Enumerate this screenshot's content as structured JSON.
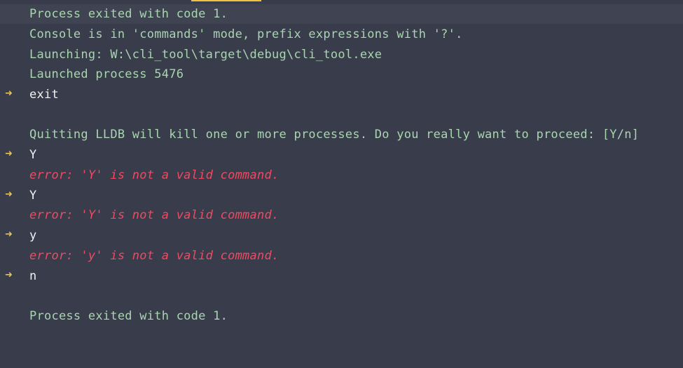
{
  "console": {
    "lines": [
      {
        "kind": "output",
        "text": "Process exited with code 1."
      },
      {
        "kind": "output",
        "text": "Console is in 'commands' mode, prefix expressions with '?'."
      },
      {
        "kind": "output",
        "text": "Launching: W:\\cli_tool\\target\\debug\\cli_tool.exe"
      },
      {
        "kind": "output",
        "text": "Launched process 5476"
      },
      {
        "kind": "command",
        "prompt": "➜",
        "text": "exit"
      },
      {
        "kind": "output",
        "text": "Quitting LLDB will kill one or more processes. Do you really want to proceed: [Y/n]"
      },
      {
        "kind": "command",
        "prompt": "➜",
        "text": "Y"
      },
      {
        "kind": "error",
        "text": "error: 'Y' is not a valid command."
      },
      {
        "kind": "command",
        "prompt": "➜",
        "text": "Y"
      },
      {
        "kind": "error",
        "text": "error: 'Y' is not a valid command."
      },
      {
        "kind": "command",
        "prompt": "➜",
        "text": "y"
      },
      {
        "kind": "error",
        "text": "error: 'y' is not a valid command."
      },
      {
        "kind": "command",
        "prompt": "➜",
        "text": "n"
      },
      {
        "kind": "output",
        "text": "Process exited with code 1."
      }
    ]
  },
  "colors": {
    "background": "#393c4a",
    "output_text": "#a9d5b0",
    "command_text": "#f2f2f2",
    "error_text": "#f04a63",
    "prompt_arrow": "#e8c05a"
  }
}
